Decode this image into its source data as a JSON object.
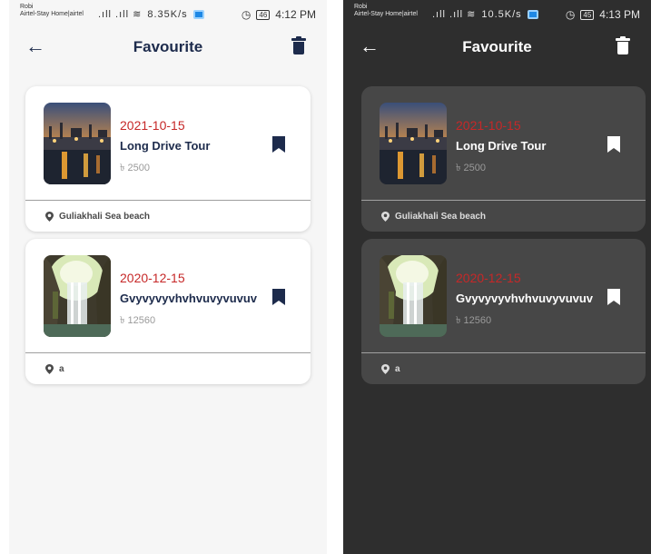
{
  "status_left": {
    "carrier1": "Robi",
    "carrier2": "Airtel-Stay Home|airtel",
    "signals": ".ıll .ıll ≋"
  },
  "screens": [
    {
      "theme": "light",
      "speed": "8.35K/s",
      "battery": "46",
      "time": "4:12 PM",
      "title": "Favourite",
      "cards": [
        {
          "date": "2021-10-15",
          "name": "Long Drive Tour",
          "price": "৳ 2500",
          "location": "Guliakhali Sea beach",
          "thumb": "harbor-sunset"
        },
        {
          "date": "2020-12-15",
          "name": "Gvyvyvyvhvhvuvyvuvuv",
          "price": "৳ 12560",
          "location": "a",
          "thumb": "waterfall-cave"
        }
      ]
    },
    {
      "theme": "dark",
      "speed": "10.5K/s",
      "battery": "45",
      "time": "4:13 PM",
      "title": "Favourite",
      "cards": [
        {
          "date": "2021-10-15",
          "name": "Long Drive Tour",
          "price": "৳ 2500",
          "location": "Guliakhali Sea beach",
          "thumb": "harbor-sunset"
        },
        {
          "date": "2020-12-15",
          "name": "Gvyvyvyvhvhvuvyvuvuv",
          "price": "৳ 12560",
          "location": "a",
          "thumb": "waterfall-cave"
        }
      ]
    }
  ],
  "colors": {
    "navy": "#1d2b4c",
    "date_red": "#c62828",
    "dark_bg": "#2e2e2e",
    "dark_card": "#474747"
  }
}
